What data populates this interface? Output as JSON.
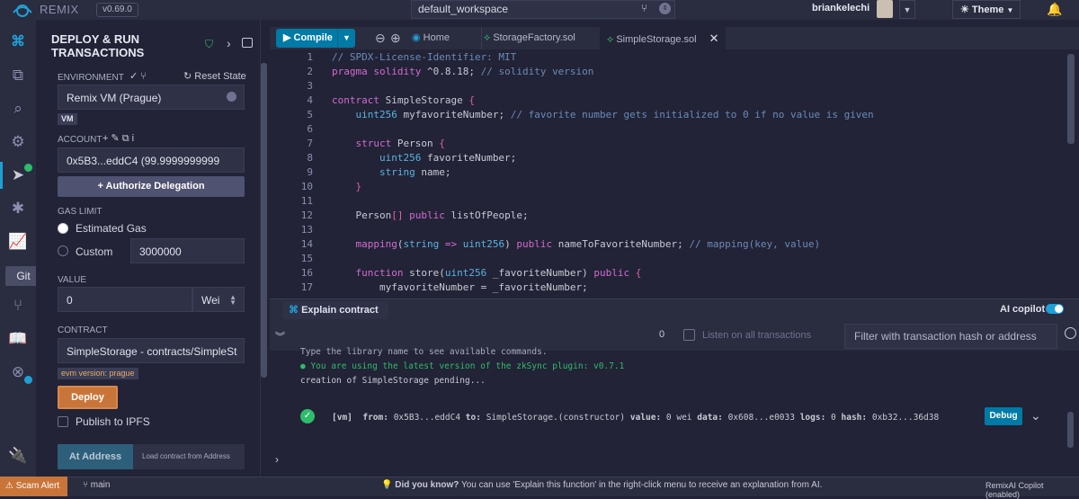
{
  "topbar": {
    "app_name": "REMIX",
    "version": "v0.69.0",
    "workspace": "default_workspace",
    "username": "briankelechi",
    "theme_label": "Theme"
  },
  "rail": {
    "git_tooltip": "Git"
  },
  "deploy": {
    "title_line1": "DEPLOY & RUN",
    "title_line2": "TRANSACTIONS",
    "environment_label": "ENVIRONMENT",
    "reset_state": "Reset State",
    "environment_value": "Remix VM (Prague)",
    "vm_badge": "VM",
    "account_label": "ACCOUNT",
    "account_value": "0x5B3...eddC4 (99.9999999999",
    "authorize_button": "Authorize Delegation",
    "gas_limit_label": "GAS LIMIT",
    "estimated_gas": "Estimated Gas",
    "custom": "Custom",
    "gas_value": "3000000",
    "value_label": "VALUE",
    "value_amount": "0",
    "value_unit": "Wei",
    "contract_label": "CONTRACT",
    "contract_value": "SimpleStorage - contracts/SimpleSt",
    "evm_badge": "evm version: prague",
    "deploy_button": "Deploy",
    "publish_ipfs": "Publish to IPFS",
    "at_address_button": "At Address",
    "load_contract": "Load contract from Address"
  },
  "tabs": {
    "compile": "Compile",
    "home": "Home",
    "file1": "StorageFactory.sol",
    "file2": "SimpleStorage.sol"
  },
  "editor": {
    "lines": [
      "1",
      "2",
      "3",
      "4",
      "5",
      "6",
      "7",
      "8",
      "9",
      "10",
      "11",
      "12",
      "13",
      "14",
      "15",
      "16",
      "17"
    ]
  },
  "ai": {
    "explain_contract": "Explain contract",
    "copilot": "AI copilot"
  },
  "terminal": {
    "count": "0",
    "listen_label": "Listen on all transactions",
    "filter_placeholder": "Filter with transaction hash or address",
    "line1": "Type the library name to see available commands.",
    "line2": "You are using the latest version of the zkSync plugin: v0.7.1",
    "line3": "creation of SimpleStorage pending...",
    "tx_vm": "[vm]",
    "tx_from_label": "from:",
    "tx_from": "0x5B3...eddC4",
    "tx_to_label": "to:",
    "tx_to": "SimpleStorage.(constructor)",
    "tx_value_label": "value:",
    "tx_value": "0 wei",
    "tx_data_label": "data:",
    "tx_data": "0x608...e0033",
    "tx_logs_label": "logs:",
    "tx_logs": "0",
    "tx_hash_label": "hash:",
    "tx_hash": "0xb32...36d38",
    "debug_button": "Debug"
  },
  "status": {
    "scam_alert": "Scam Alert",
    "branch": "main",
    "did_you_know": "Did you know?",
    "tip": "You can use 'Explain this function' in the right-click menu to receive an explanation from AI.",
    "copilot_status": "RemixAI Copilot (enabled)"
  },
  "colors": {
    "accent": "#007aa6",
    "deploy": "#c97539",
    "background": "#222336"
  }
}
